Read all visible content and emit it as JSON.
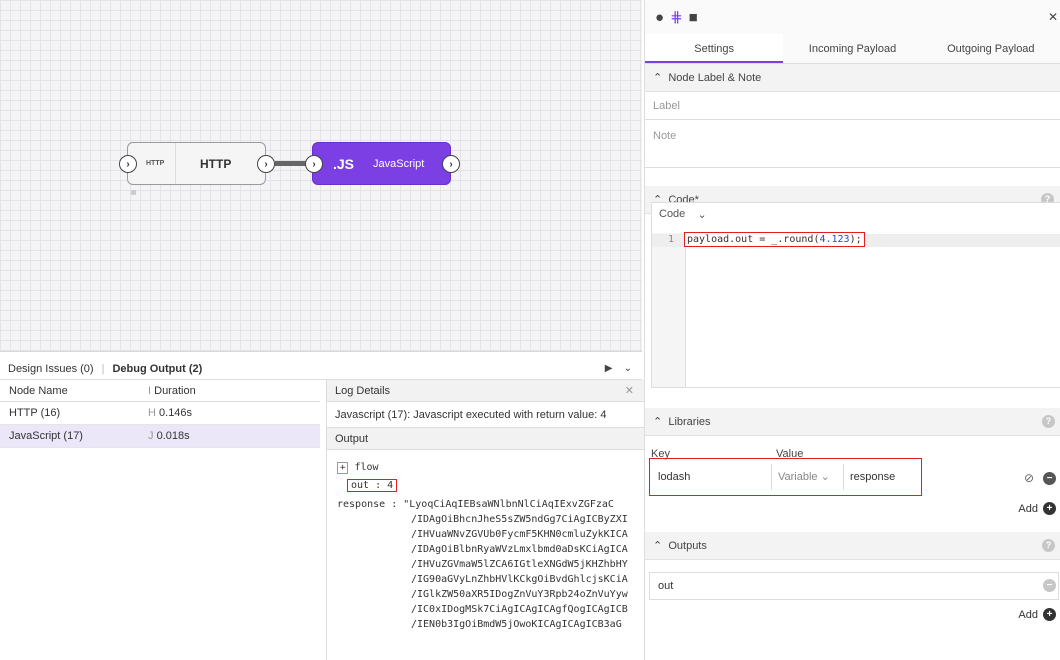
{
  "canvas": {
    "http_node": {
      "tag": "HTTP",
      "title": "HTTP"
    },
    "js_node": {
      "tag": ".JS",
      "title": "JavaScript"
    }
  },
  "bottom": {
    "tab_design": "Design Issues (0)",
    "tab_debug": "Debug Output (2)",
    "debug_table": {
      "col_node": "Node Name",
      "col_duration": "Duration",
      "rows": [
        {
          "name": "HTTP (16)",
          "prefix": "H",
          "duration": "0.146s"
        },
        {
          "name": "JavaScript (17)",
          "prefix": "J",
          "duration": "0.018s"
        }
      ]
    },
    "log": {
      "header": "Log Details",
      "message": "Javascript (17): Javascript executed with return value: 4",
      "output_label": "Output",
      "tree_flow": "flow",
      "tree_out": "out : 4",
      "response_key": "response",
      "response_lines": [
        "\"LyoqCiAqIEBsaWNlbnNlCiAqIExvZGFzaC",
        "/IDAgOiBhcnJheS5sZW5ndGg7CiAgICByZXI",
        "/IHVuaWNvZGVUb0FycmF5KHN0cmluZykKICA",
        "/IDAgOiBlbnRyaWVzLmxlbmd0aDsKCiAgICA",
        "/IHVuZGVmaW5lZCA6IGtleXNGdW5jKHZhbHY",
        "/IG90aGVyLnZhbHVlKCkgOiBvdGhlcjsKCiA",
        "/IGlkZW50aXR5IDogZnVuY3Rpb24oZnVuYyw",
        "/IC0xIDogMSk7CiAgICAgICAgfQogICAgICB",
        "/IEN0b3IgOiBmdW5jOwoKICAgICAgICB3aG"
      ]
    }
  },
  "panel": {
    "tabs": [
      "Settings",
      "Incoming Payload",
      "Outgoing Payload"
    ],
    "section_label_note": "Node Label & Note",
    "label_placeholder": "Label",
    "note_placeholder": "Note",
    "section_code": "Code*",
    "code_mode": "Code",
    "code_line_number": "1",
    "code_text_var": "payload.out",
    "code_text_eq": " = ",
    "code_text_fn": "_.round(",
    "code_text_num": "4.123",
    "code_text_end": ");",
    "section_libraries": "Libraries",
    "lib_key_header": "Key",
    "lib_value_header": "Value",
    "lib_key": "lodash",
    "lib_type": "Variable",
    "lib_value": "response",
    "add_label": "Add",
    "section_outputs": "Outputs",
    "output_value": "out"
  }
}
